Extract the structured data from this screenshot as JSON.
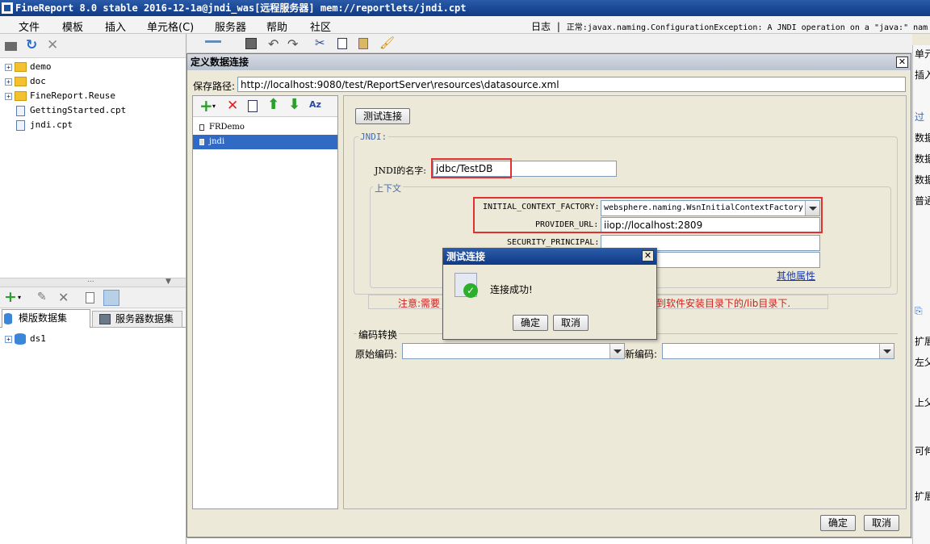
{
  "window": {
    "title": "FineReport 8.0 stable 2016-12-1a@jndi_was[远程服务器]    mem://reportlets/jndi.cpt"
  },
  "menu": [
    "文件",
    "模板",
    "插入",
    "单元格(C)",
    "服务器",
    "帮助",
    "社区"
  ],
  "log": {
    "label": "日志",
    "status": "正常:javax.naming.ConfigurationException: A JNDI operation on a \"java:\" nam"
  },
  "file_tree": [
    "demo",
    "doc",
    "FineReport.Reuse",
    "GettingStarted.cpt",
    "jndi.cpt"
  ],
  "dataset_tabs": {
    "template": "模版数据集",
    "server": "服务器数据集"
  },
  "datasets": [
    "ds1"
  ],
  "right_panel": [
    "单元",
    "插入内",
    "过",
    "数据集",
    "数据列",
    "数据设",
    "普通",
    "",
    "扩展",
    "左父",
    "上父",
    "可伸展",
    "扩展"
  ],
  "dialog": {
    "title": "定义数据连接",
    "save_path_label": "保存路径:",
    "save_path": "http://localhost:9080/test/ReportServer\\resources\\datasource.xml",
    "connections": [
      "FRDemo",
      "jndi"
    ],
    "test_button": "测试连接",
    "jndi_legend": "JNDI:",
    "jndi_name_label": "JNDI的名字:",
    "jndi_name": "jdbc/TestDB",
    "context_legend": "上下文",
    "factory_label": "INITIAL_CONTEXT_FACTORY:",
    "factory_value": "websphere.naming.WsnInitialContextFactory",
    "provider_label": "PROVIDER_URL:",
    "provider_value": "iiop://localhost:2809",
    "principal_label": "SECURITY_PRINCIPAL:",
    "other_props": "其他属性",
    "note_left": "注意:需要",
    "note_right": "到软件安装目录下的/lib目录下.",
    "encoding_legend": "编码转换",
    "orig_encoding": "原始编码:",
    "new_encoding": "新编码:",
    "ok": "确定",
    "cancel": "取消"
  },
  "popup": {
    "title": "测试连接",
    "message": "连接成功!",
    "ok": "确定",
    "cancel": "取消"
  }
}
